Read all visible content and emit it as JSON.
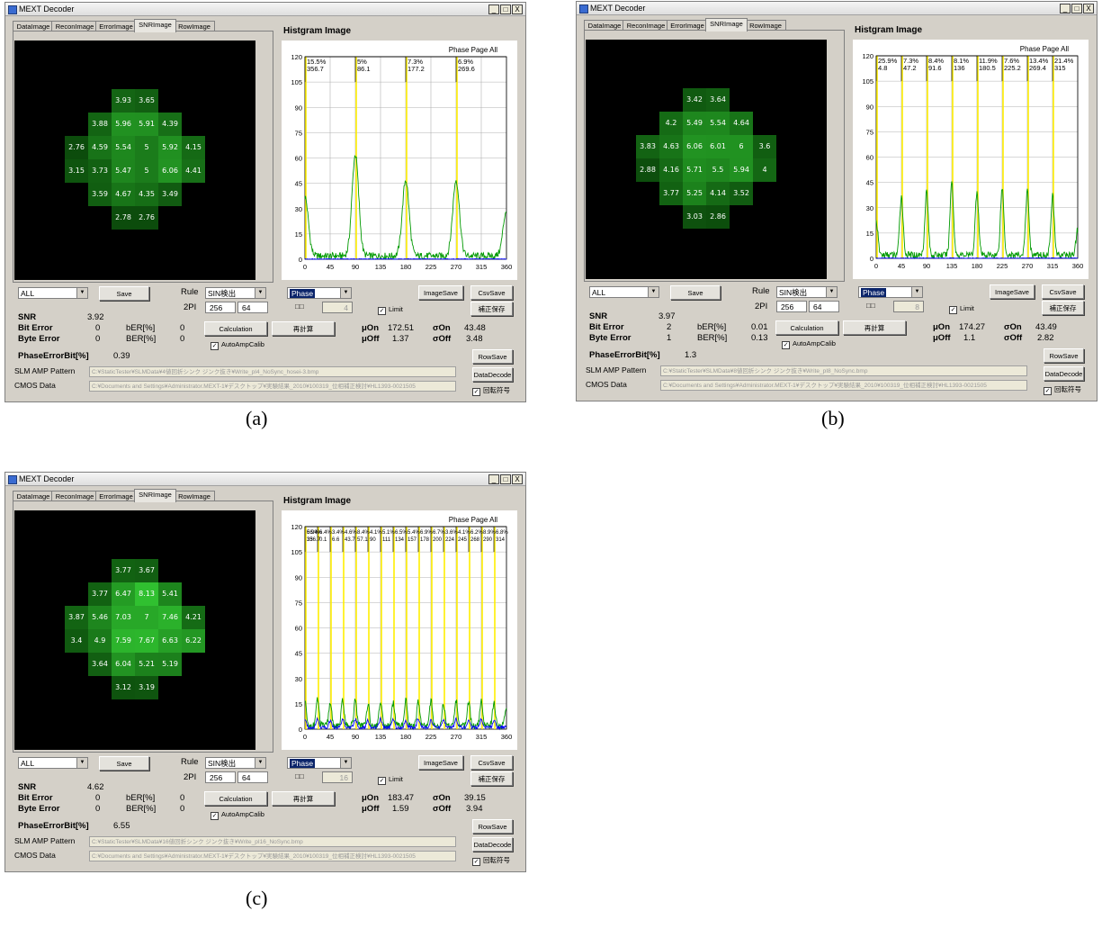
{
  "common": {
    "title": "MEXT Decoder",
    "minimize": "_",
    "maximize": "□",
    "close": "X",
    "tabs": [
      "DataImage",
      "ReconImage",
      "ErrorImage",
      "SNRImage",
      "RowImage"
    ],
    "hist_title": "Histgram Image",
    "hist_label": "Phase Page All",
    "y_ticks": [
      "120",
      "105",
      "90",
      "75",
      "60",
      "45",
      "30",
      "15",
      "0"
    ],
    "x_ticks": [
      "0",
      "45",
      "90",
      "135",
      "180",
      "225",
      "270",
      "315",
      "360"
    ],
    "all_select": "ALL",
    "save": "Save",
    "rule_label": "Rule",
    "rule_value": "SIN検出",
    "twopi_label": "2PI",
    "twopi_a": "256",
    "twopi_b": "64",
    "phase_select": "Phase",
    "small_label": "□□",
    "limit_label": "Limit",
    "image_save": "ImageSave",
    "csv_save": "CsvSave",
    "correction_save": "補正保存",
    "snr_label": "SNR",
    "bit_error_label": "Bit Error",
    "byte_error_label": "Byte Error",
    "ber_small_label": "bER[%]",
    "ber_large_label": "BER[%]",
    "calculation": "Calculation",
    "recalc": "再計算",
    "auto_amp": "AutoAmpCalib",
    "mu_on_label": "μOn",
    "mu_off_label": "μOff",
    "sigma_on_label": "σOn",
    "sigma_off_label": "σOff",
    "phase_error_label": "PhaseErrorBit[%]",
    "row_save": "RowSave",
    "data_decode": "DataDecode",
    "slm_label": "SLM AMP Pattern",
    "cmos_label": "CMOS Data",
    "rotation_label": "回転符号",
    "cmos_path": "C:¥Documents and Settings¥Administrator.MEXT-1¥デスクトップ¥実験結果_2010¥100319_位相補正検討¥HL1393-0021505"
  },
  "windows": [
    {
      "caption": "(a)",
      "small_value": "4",
      "snr": "3.92",
      "bit_error": "0",
      "byte_error": "0",
      "ber_small": "0",
      "ber_large": "0",
      "mu_on": "172.51",
      "mu_off": "1.37",
      "sigma_on": "43.48",
      "sigma_off": "3.48",
      "phase_error": "0.39",
      "slm_path": "C:¥StaticTester¥SLMData¥4値回折シンク ジンク抜き¥Write_pI4_NoSync_hosei-3.bmp",
      "grid": [
        [
          "",
          "",
          "",
          "3.93",
          "3.65",
          "",
          "",
          ""
        ],
        [
          "",
          "",
          "3.88",
          "5.96",
          "5.91",
          "4.39",
          "",
          ""
        ],
        [
          "",
          "2.76",
          "4.59",
          "5.54",
          "5",
          "5.92",
          "4.15",
          ""
        ],
        [
          "",
          "3.15",
          "3.73",
          "5.47",
          "5",
          "6.06",
          "4.41",
          ""
        ],
        [
          "",
          "",
          "3.59",
          "4.67",
          "4.35",
          "3.49",
          "",
          ""
        ],
        [
          "",
          "",
          "",
          "2.78",
          "2.76",
          "",
          "",
          ""
        ]
      ],
      "phase_labels": [
        {
          "pct": "15.5%",
          "val": "356.7"
        },
        {
          "pct": "5%",
          "val": "86.1"
        },
        {
          "pct": "7.3%",
          "val": "177.2"
        },
        {
          "pct": "6.9%",
          "val": "269.6"
        }
      ],
      "chart_data": {
        "type": "line",
        "title": "Histgram Image",
        "xlim": [
          0,
          360
        ],
        "ylim": [
          0,
          120
        ],
        "phase_markers": [
          0,
          90,
          180,
          270
        ],
        "series": [
          {
            "name": "",
            "color": "#009900",
            "peaks": [
              [
                0,
                35
              ],
              [
                90,
                60
              ],
              [
                180,
                45
              ],
              [
                270,
                45
              ],
              [
                360,
                27
              ]
            ],
            "width": 6
          },
          {
            "name": "",
            "color": "#0000ff",
            "peaks": [],
            "width": 6
          }
        ]
      }
    },
    {
      "caption": "(b)",
      "small_value": "8",
      "snr": "3.97",
      "bit_error": "2",
      "byte_error": "1",
      "ber_small": "0.01",
      "ber_large": "0.13",
      "mu_on": "174.27",
      "mu_off": "1.1",
      "sigma_on": "43.49",
      "sigma_off": "2.82",
      "phase_error": "1.3",
      "slm_path": "C:¥StaticTester¥SLMData¥8値回折シンク ジンク抜き¥Write_pI8_NoSync.bmp",
      "grid": [
        [
          "",
          "",
          "",
          "3.42",
          "3.64",
          "",
          "",
          ""
        ],
        [
          "",
          "",
          "4.2",
          "5.49",
          "5.54",
          "4.64",
          "",
          ""
        ],
        [
          "",
          "3.83",
          "4.63",
          "6.06",
          "6.01",
          "6",
          "3.6",
          ""
        ],
        [
          "",
          "2.88",
          "4.16",
          "5.71",
          "5.5",
          "5.94",
          "4",
          ""
        ],
        [
          "",
          "",
          "3.77",
          "5.25",
          "4.14",
          "3.52",
          "",
          ""
        ],
        [
          "",
          "",
          "",
          "3.03",
          "2.86",
          "",
          "",
          ""
        ]
      ],
      "phase_labels": [
        {
          "pct": "25.9%",
          "val": "4.8"
        },
        {
          "pct": "7.3%",
          "val": "47.2"
        },
        {
          "pct": "8.4%",
          "val": "91.6"
        },
        {
          "pct": "8.1%",
          "val": "136"
        },
        {
          "pct": "11.9%",
          "val": "180.5"
        },
        {
          "pct": "7.6%",
          "val": "225.2"
        },
        {
          "pct": "13.4%",
          "val": "269.4"
        },
        {
          "pct": "21.4%",
          "val": "315"
        }
      ],
      "chart_data": {
        "type": "line",
        "title": "Histgram Image",
        "xlim": [
          0,
          360
        ],
        "ylim": [
          0,
          120
        ],
        "phase_markers": [
          0,
          45,
          90,
          135,
          180,
          225,
          270,
          315
        ],
        "series": [
          {
            "name": "",
            "color": "#009900",
            "peaks": [
              [
                0,
                20
              ],
              [
                45,
                35
              ],
              [
                90,
                38
              ],
              [
                135,
                44
              ],
              [
                180,
                38
              ],
              [
                225,
                40
              ],
              [
                270,
                38
              ],
              [
                315,
                35
              ],
              [
                360,
                15
              ]
            ],
            "width": 3
          },
          {
            "name": "",
            "color": "#0000ff",
            "peaks": [],
            "width": 3
          }
        ]
      }
    },
    {
      "caption": "(c)",
      "small_value": "16",
      "snr": "4.62",
      "bit_error": "0",
      "byte_error": "0",
      "ber_small": "0",
      "ber_large": "0",
      "mu_on": "183.47",
      "mu_off": "1.59",
      "sigma_on": "39.15",
      "sigma_off": "3.94",
      "phase_error": "6.55",
      "slm_path": "C:¥StaticTester¥SLMData¥16値回折シンク ジンク抜き¥Write_pI16_NoSync.bmp",
      "grid": [
        [
          "",
          "",
          "",
          "3.77",
          "3.67",
          "",
          "",
          ""
        ],
        [
          "",
          "",
          "3.77",
          "6.47",
          "8.13",
          "5.41",
          "",
          ""
        ],
        [
          "",
          "3.87",
          "5.46",
          "7.03",
          "7",
          "7.46",
          "4.21",
          ""
        ],
        [
          "",
          "3.4",
          "4.9",
          "7.59",
          "7.67",
          "6.63",
          "6.22",
          ""
        ],
        [
          "",
          "",
          "3.64",
          "6.04",
          "5.21",
          "5.19",
          "",
          ""
        ],
        [
          "",
          "",
          "",
          "3.12",
          "3.19",
          "",
          "",
          ""
        ]
      ],
      "phase_labels": [
        {
          "pct": "56.4%",
          "val": "35"
        },
        {
          "pct": "6.4%",
          "val": "0.1"
        },
        {
          "pct": "3.4%",
          "val": "6.6"
        },
        {
          "pct": "4.6%",
          "val": "43.7"
        },
        {
          "pct": "8.4%",
          "val": "57.1"
        },
        {
          "pct": "4.1%",
          "val": "90"
        },
        {
          "pct": "5.1%",
          "val": "111"
        },
        {
          "pct": "6.5%",
          "val": "134"
        },
        {
          "pct": "5.4%",
          "val": "157"
        },
        {
          "pct": "6.9%",
          "val": "178"
        },
        {
          "pct": "6.7%",
          "val": "200"
        },
        {
          "pct": "3.6%",
          "val": "224"
        },
        {
          "pct": "4.1%",
          "val": "245"
        },
        {
          "pct": "6.2%",
          "val": "268"
        },
        {
          "pct": "8.9%",
          "val": "290"
        },
        {
          "pct": "6.8%",
          "val": "314"
        },
        {
          "pct": "6.9%",
          "val": "336.7"
        }
      ],
      "chart_data": {
        "type": "line",
        "title": "Histgram Image",
        "xlim": [
          0,
          360
        ],
        "ylim": [
          0,
          120
        ],
        "phase_markers": [
          0,
          22.5,
          45,
          67.5,
          90,
          112.5,
          135,
          157.5,
          180,
          202.5,
          225,
          247.5,
          270,
          292.5,
          315,
          337.5
        ],
        "series": [
          {
            "name": "",
            "color": "#009900",
            "peaks": [
              [
                0,
                14
              ],
              [
                22.5,
                16
              ],
              [
                45,
                14
              ],
              [
                67.5,
                15
              ],
              [
                90,
                16
              ],
              [
                112.5,
                13
              ],
              [
                135,
                15
              ],
              [
                157.5,
                14
              ],
              [
                180,
                16
              ],
              [
                202.5,
                14
              ],
              [
                225,
                15
              ],
              [
                247.5,
                13
              ],
              [
                270,
                15
              ],
              [
                292.5,
                14
              ],
              [
                315,
                15
              ],
              [
                337.5,
                14
              ],
              [
                360,
                12
              ]
            ],
            "width": 2.5
          },
          {
            "name": "",
            "color": "#0000ff",
            "peaks": [
              [
                0,
                5
              ],
              [
                22.5,
                5
              ],
              [
                45,
                4
              ],
              [
                67.5,
                5
              ],
              [
                90,
                5
              ],
              [
                112.5,
                4
              ],
              [
                135,
                5
              ],
              [
                157.5,
                5
              ],
              [
                180,
                4
              ],
              [
                202.5,
                5
              ],
              [
                225,
                4
              ],
              [
                247.5,
                5
              ],
              [
                270,
                5
              ],
              [
                292.5,
                4
              ],
              [
                315,
                5
              ],
              [
                337.5,
                4
              ]
            ],
            "width": 2.5
          }
        ]
      }
    }
  ]
}
